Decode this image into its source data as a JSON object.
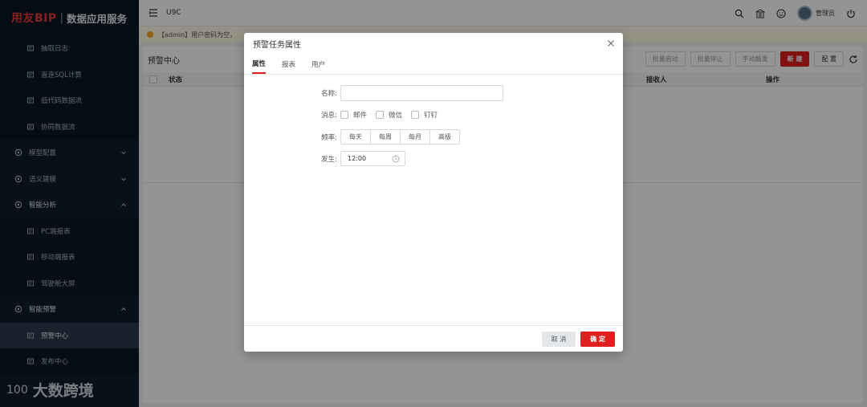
{
  "brand": {
    "logo": "用友BIP",
    "separator": "|",
    "name": "数据应用服务"
  },
  "sidebar": {
    "items": [
      {
        "label": "抽取日志",
        "type": "sub",
        "icon": "log-icon"
      },
      {
        "label": "直连SQL计算",
        "type": "sub",
        "icon": "sql-icon"
      },
      {
        "label": "低代码数据流",
        "type": "sub",
        "icon": "flow-icon"
      },
      {
        "label": "协同数据流",
        "type": "sub",
        "icon": "collab-icon"
      },
      {
        "label": "模型配置",
        "type": "group",
        "icon": "model-icon",
        "chevron": "down"
      },
      {
        "label": "语义建模",
        "type": "group",
        "icon": "semantic-icon",
        "chevron": "down"
      },
      {
        "label": "智能分析",
        "type": "group",
        "icon": "analysis-icon",
        "chevron": "up"
      },
      {
        "label": "PC端报表",
        "type": "sub",
        "icon": "pc-icon"
      },
      {
        "label": "移动端报表",
        "type": "sub",
        "icon": "mobile-icon"
      },
      {
        "label": "驾驶舱大屏",
        "type": "sub",
        "icon": "screen-icon"
      },
      {
        "label": "智能预警",
        "type": "group",
        "icon": "alert-icon",
        "chevron": "up"
      },
      {
        "label": "预警中心",
        "type": "sub",
        "icon": "bell-icon",
        "active": true
      },
      {
        "label": "发布中心",
        "type": "sub",
        "icon": "publish-icon"
      }
    ]
  },
  "watermark": {
    "logo": "100",
    "text": "大数跨境"
  },
  "topbar": {
    "org": "U9C",
    "user": "管理员"
  },
  "notice": {
    "text": "【admin】用户密码为空，"
  },
  "main": {
    "title": "预警中心",
    "toolbar": {
      "batch_start": "批量启动",
      "batch_stop": "批量停止",
      "manual_trigger": "手动触发",
      "new": "新 建",
      "config": "配 置"
    },
    "columns": {
      "status": "状态",
      "receiver": "接收人",
      "action": "操作"
    }
  },
  "modal": {
    "title": "预警任务属性",
    "tabs": [
      "属性",
      "报表",
      "用户"
    ],
    "active_tab": 0,
    "form": {
      "name_label": "名称:",
      "name_value": "",
      "message_label": "消息:",
      "message_options": [
        "邮件",
        "微信",
        "钉钉"
      ],
      "frequency_label": "频率:",
      "frequency_options": [
        "每天",
        "每周",
        "每月",
        "高级"
      ],
      "occur_label": "发生:",
      "occur_time": "12:00"
    },
    "cancel": "取 消",
    "ok": "确 定"
  },
  "colors": {
    "accent": "#e02020",
    "sidebar_bg": "#0f1c2b",
    "notice_dot": "#f5a623"
  }
}
